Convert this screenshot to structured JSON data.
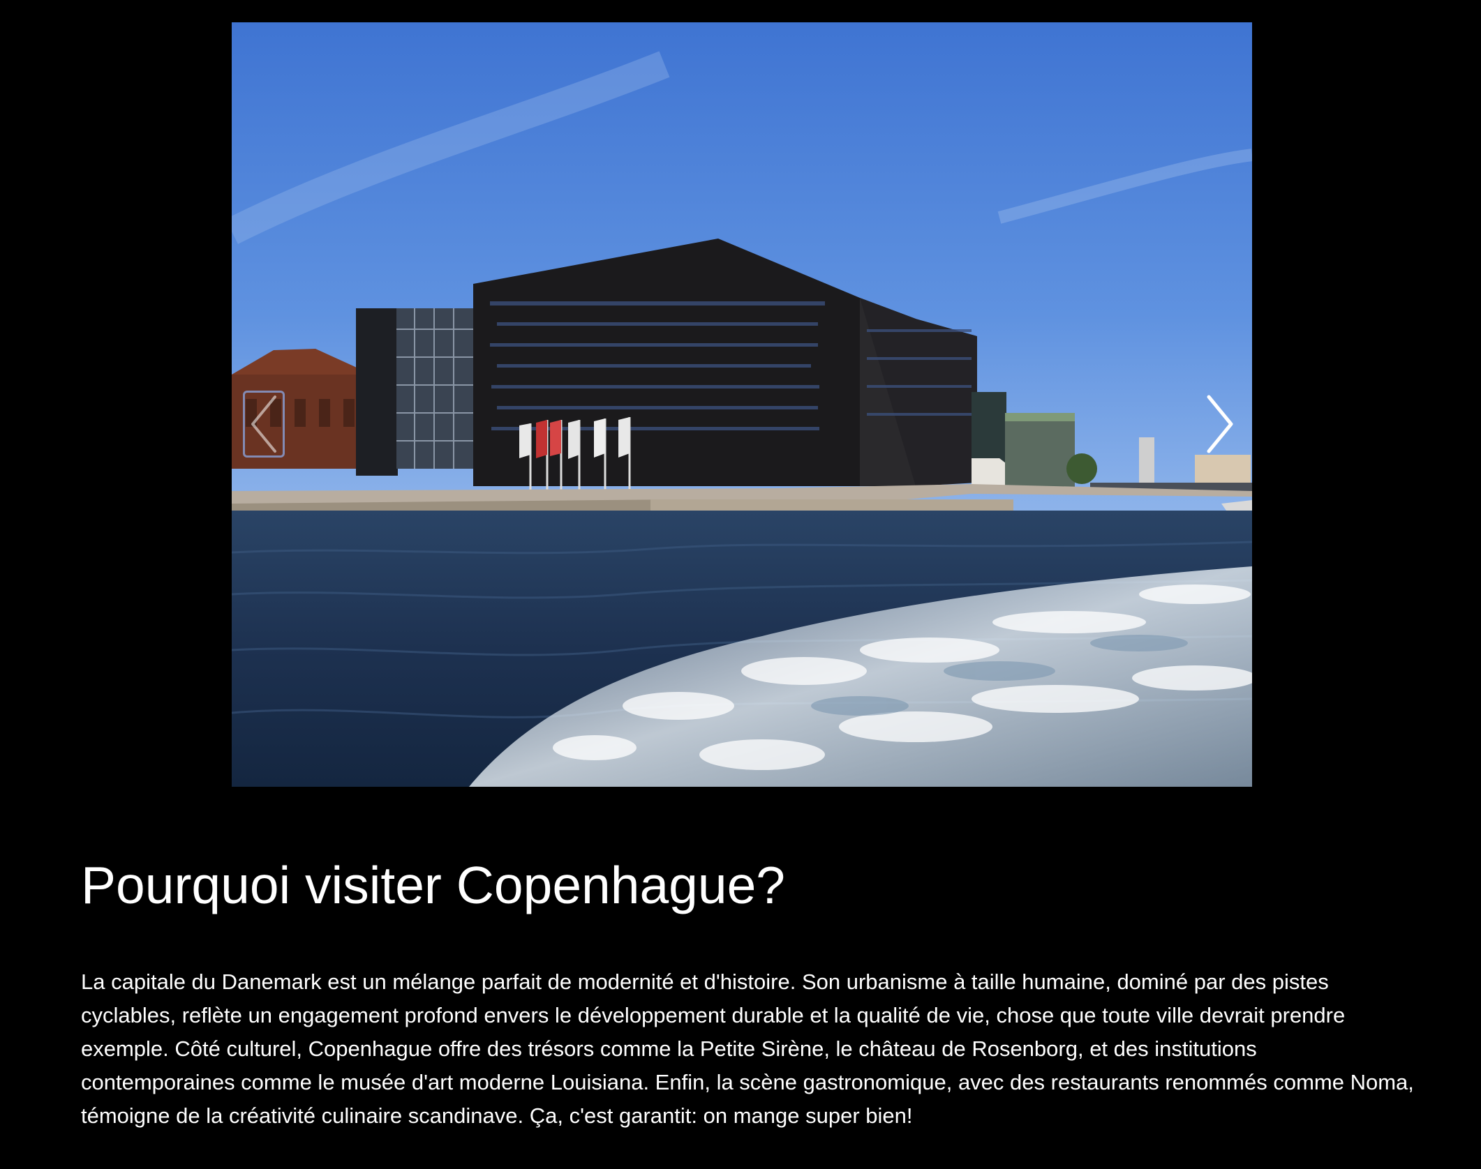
{
  "carousel": {
    "image_alt": "Bibliothèque royale (Diamant noir) au bord de l'eau à Copenhague",
    "prev_icon": "chevron-left-icon",
    "next_icon": "chevron-right-icon",
    "nav_color": "#ffffff",
    "prev_border_color": "#8caae6"
  },
  "article": {
    "title": "Pourquoi visiter Copenhague?",
    "body": "La capitale du Danemark est un mélange parfait de modernité et d'histoire. Son urbanisme à taille humaine, dominé par des pistes cyclables, reflète un engagement profond envers le développement durable et la qualité de vie, chose que toute ville devrait prendre exemple. Côté culturel, Copenhague offre des trésors comme la Petite Sirène, le château de Rosenborg, et des institutions contemporaines comme le musée d'art moderne Louisiana. Enfin, la scène gastronomique, avec des restaurants renommés comme Noma, témoigne de la créativité culinaire scandinave. Ça, c'est garantit: on mange super bien!"
  },
  "colors": {
    "background": "#000000",
    "text": "#ffffff",
    "sky": "#4a7fd6",
    "water": "#1e3350"
  }
}
